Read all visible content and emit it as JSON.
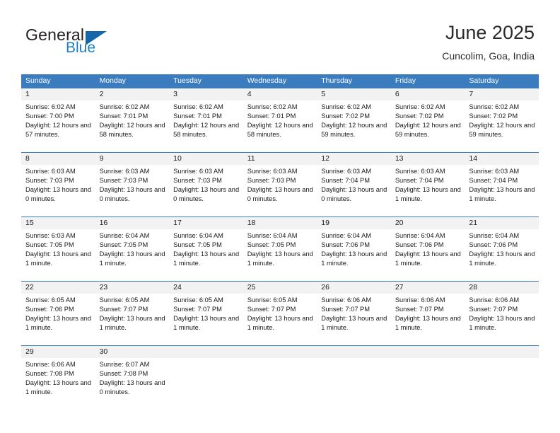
{
  "brand": {
    "name_part1": "General",
    "name_part2": "Blue",
    "triangle_icon": "blue-triangle-icon",
    "color_dark": "#231f20",
    "color_blue": "#1f7fc4"
  },
  "header": {
    "title": "June 2025",
    "subtitle": "Cuncolim, Goa, India"
  },
  "theme": {
    "header_row_bg": "#3a7cbe",
    "day_number_bg": "#f2f2f2",
    "row_divider": "#3a7cbe",
    "text": "#1a1a1a"
  },
  "weekdays": [
    "Sunday",
    "Monday",
    "Tuesday",
    "Wednesday",
    "Thursday",
    "Friday",
    "Saturday"
  ],
  "weeks": [
    {
      "days": [
        {
          "num": "1",
          "sunrise": "Sunrise: 6:02 AM",
          "sunset": "Sunset: 7:00 PM",
          "daylight": "Daylight: 12 hours and 57 minutes."
        },
        {
          "num": "2",
          "sunrise": "Sunrise: 6:02 AM",
          "sunset": "Sunset: 7:01 PM",
          "daylight": "Daylight: 12 hours and 58 minutes."
        },
        {
          "num": "3",
          "sunrise": "Sunrise: 6:02 AM",
          "sunset": "Sunset: 7:01 PM",
          "daylight": "Daylight: 12 hours and 58 minutes."
        },
        {
          "num": "4",
          "sunrise": "Sunrise: 6:02 AM",
          "sunset": "Sunset: 7:01 PM",
          "daylight": "Daylight: 12 hours and 58 minutes."
        },
        {
          "num": "5",
          "sunrise": "Sunrise: 6:02 AM",
          "sunset": "Sunset: 7:02 PM",
          "daylight": "Daylight: 12 hours and 59 minutes."
        },
        {
          "num": "6",
          "sunrise": "Sunrise: 6:02 AM",
          "sunset": "Sunset: 7:02 PM",
          "daylight": "Daylight: 12 hours and 59 minutes."
        },
        {
          "num": "7",
          "sunrise": "Sunrise: 6:02 AM",
          "sunset": "Sunset: 7:02 PM",
          "daylight": "Daylight: 12 hours and 59 minutes."
        }
      ]
    },
    {
      "days": [
        {
          "num": "8",
          "sunrise": "Sunrise: 6:03 AM",
          "sunset": "Sunset: 7:03 PM",
          "daylight": "Daylight: 13 hours and 0 minutes."
        },
        {
          "num": "9",
          "sunrise": "Sunrise: 6:03 AM",
          "sunset": "Sunset: 7:03 PM",
          "daylight": "Daylight: 13 hours and 0 minutes."
        },
        {
          "num": "10",
          "sunrise": "Sunrise: 6:03 AM",
          "sunset": "Sunset: 7:03 PM",
          "daylight": "Daylight: 13 hours and 0 minutes."
        },
        {
          "num": "11",
          "sunrise": "Sunrise: 6:03 AM",
          "sunset": "Sunset: 7:03 PM",
          "daylight": "Daylight: 13 hours and 0 minutes."
        },
        {
          "num": "12",
          "sunrise": "Sunrise: 6:03 AM",
          "sunset": "Sunset: 7:04 PM",
          "daylight": "Daylight: 13 hours and 0 minutes."
        },
        {
          "num": "13",
          "sunrise": "Sunrise: 6:03 AM",
          "sunset": "Sunset: 7:04 PM",
          "daylight": "Daylight: 13 hours and 1 minute."
        },
        {
          "num": "14",
          "sunrise": "Sunrise: 6:03 AM",
          "sunset": "Sunset: 7:04 PM",
          "daylight": "Daylight: 13 hours and 1 minute."
        }
      ]
    },
    {
      "days": [
        {
          "num": "15",
          "sunrise": "Sunrise: 6:03 AM",
          "sunset": "Sunset: 7:05 PM",
          "daylight": "Daylight: 13 hours and 1 minute."
        },
        {
          "num": "16",
          "sunrise": "Sunrise: 6:04 AM",
          "sunset": "Sunset: 7:05 PM",
          "daylight": "Daylight: 13 hours and 1 minute."
        },
        {
          "num": "17",
          "sunrise": "Sunrise: 6:04 AM",
          "sunset": "Sunset: 7:05 PM",
          "daylight": "Daylight: 13 hours and 1 minute."
        },
        {
          "num": "18",
          "sunrise": "Sunrise: 6:04 AM",
          "sunset": "Sunset: 7:05 PM",
          "daylight": "Daylight: 13 hours and 1 minute."
        },
        {
          "num": "19",
          "sunrise": "Sunrise: 6:04 AM",
          "sunset": "Sunset: 7:06 PM",
          "daylight": "Daylight: 13 hours and 1 minute."
        },
        {
          "num": "20",
          "sunrise": "Sunrise: 6:04 AM",
          "sunset": "Sunset: 7:06 PM",
          "daylight": "Daylight: 13 hours and 1 minute."
        },
        {
          "num": "21",
          "sunrise": "Sunrise: 6:04 AM",
          "sunset": "Sunset: 7:06 PM",
          "daylight": "Daylight: 13 hours and 1 minute."
        }
      ]
    },
    {
      "days": [
        {
          "num": "22",
          "sunrise": "Sunrise: 6:05 AM",
          "sunset": "Sunset: 7:06 PM",
          "daylight": "Daylight: 13 hours and 1 minute."
        },
        {
          "num": "23",
          "sunrise": "Sunrise: 6:05 AM",
          "sunset": "Sunset: 7:07 PM",
          "daylight": "Daylight: 13 hours and 1 minute."
        },
        {
          "num": "24",
          "sunrise": "Sunrise: 6:05 AM",
          "sunset": "Sunset: 7:07 PM",
          "daylight": "Daylight: 13 hours and 1 minute."
        },
        {
          "num": "25",
          "sunrise": "Sunrise: 6:05 AM",
          "sunset": "Sunset: 7:07 PM",
          "daylight": "Daylight: 13 hours and 1 minute."
        },
        {
          "num": "26",
          "sunrise": "Sunrise: 6:06 AM",
          "sunset": "Sunset: 7:07 PM",
          "daylight": "Daylight: 13 hours and 1 minute."
        },
        {
          "num": "27",
          "sunrise": "Sunrise: 6:06 AM",
          "sunset": "Sunset: 7:07 PM",
          "daylight": "Daylight: 13 hours and 1 minute."
        },
        {
          "num": "28",
          "sunrise": "Sunrise: 6:06 AM",
          "sunset": "Sunset: 7:07 PM",
          "daylight": "Daylight: 13 hours and 1 minute."
        }
      ]
    },
    {
      "days": [
        {
          "num": "29",
          "sunrise": "Sunrise: 6:06 AM",
          "sunset": "Sunset: 7:08 PM",
          "daylight": "Daylight: 13 hours and 1 minute."
        },
        {
          "num": "30",
          "sunrise": "Sunrise: 6:07 AM",
          "sunset": "Sunset: 7:08 PM",
          "daylight": "Daylight: 13 hours and 0 minutes."
        },
        {
          "num": "",
          "sunrise": "",
          "sunset": "",
          "daylight": ""
        },
        {
          "num": "",
          "sunrise": "",
          "sunset": "",
          "daylight": ""
        },
        {
          "num": "",
          "sunrise": "",
          "sunset": "",
          "daylight": ""
        },
        {
          "num": "",
          "sunrise": "",
          "sunset": "",
          "daylight": ""
        },
        {
          "num": "",
          "sunrise": "",
          "sunset": "",
          "daylight": ""
        }
      ]
    }
  ]
}
